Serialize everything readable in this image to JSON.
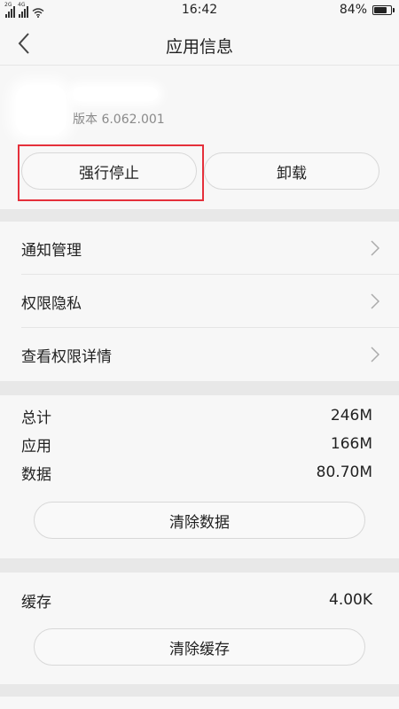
{
  "status_bar": {
    "network_1": "2G",
    "network_2": "4G",
    "time": "16:42",
    "battery_percent": "84%",
    "battery_level": 0.84
  },
  "title_bar": {
    "back_icon": "chevron-left-icon",
    "title": "应用信息"
  },
  "app": {
    "version": "版本 6.062.001"
  },
  "actions": {
    "force_stop": "强行停止",
    "uninstall": "卸载"
  },
  "menu": {
    "items": [
      {
        "label": "通知管理",
        "icon": "chevron-right-icon"
      },
      {
        "label": "权限隐私",
        "icon": "chevron-right-icon"
      },
      {
        "label": "查看权限详情",
        "icon": "chevron-right-icon"
      }
    ]
  },
  "storage": {
    "rows": [
      {
        "label": "总计",
        "value": "246M"
      },
      {
        "label": "应用",
        "value": "166M"
      },
      {
        "label": "数据",
        "value": "80.70M"
      }
    ],
    "clear_data_label": "清除数据"
  },
  "cache": {
    "label": "缓存",
    "value": "4.00K",
    "clear_cache_label": "清除缓存"
  },
  "colors": {
    "highlight": "#e5303b",
    "background": "#f7f7f7",
    "separator": "#e8e8e8"
  }
}
